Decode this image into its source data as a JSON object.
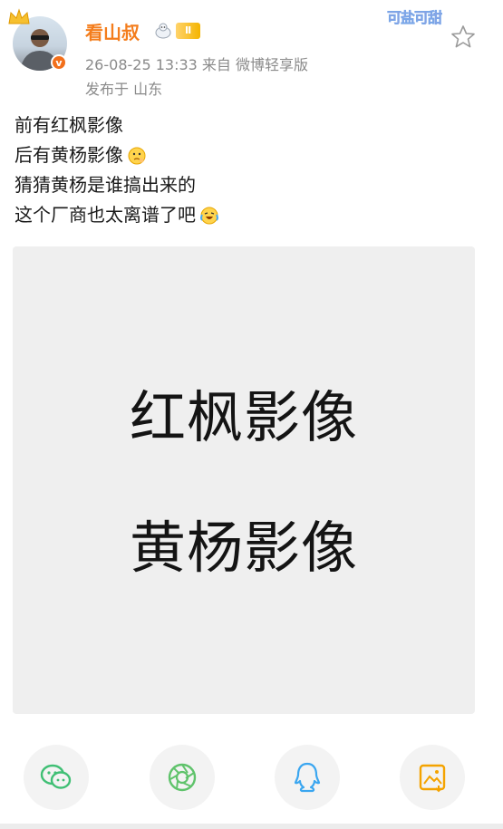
{
  "post": {
    "username": "看山叔",
    "level_badge": "Ⅱ",
    "verified_mark": "v",
    "timestamp": "26-08-25 13:33",
    "source": "来自 微博轻享版",
    "location": "发布于 山东",
    "sticker_text": "可盐可甜",
    "lines": [
      "前有红枫影像",
      "后有黄杨影像",
      "猜猜黄杨是谁搞出来的",
      "这个厂商也太离谱了吧"
    ],
    "emojis": [
      "hmm-face-emoji",
      "laugh-cry-emoji"
    ]
  },
  "image": {
    "line1": "红枫影像",
    "line2": "黄杨影像"
  },
  "share": {
    "icons": [
      "wechat-icon",
      "moments-icon",
      "qq-icon",
      "save-image-icon"
    ]
  },
  "colors": {
    "username": "#f47d1c",
    "meta": "#8a8a8a",
    "wechat": "#3fbf74",
    "moments": "#5fc36b",
    "qq": "#3aa6f0",
    "save": "#f4a300"
  }
}
